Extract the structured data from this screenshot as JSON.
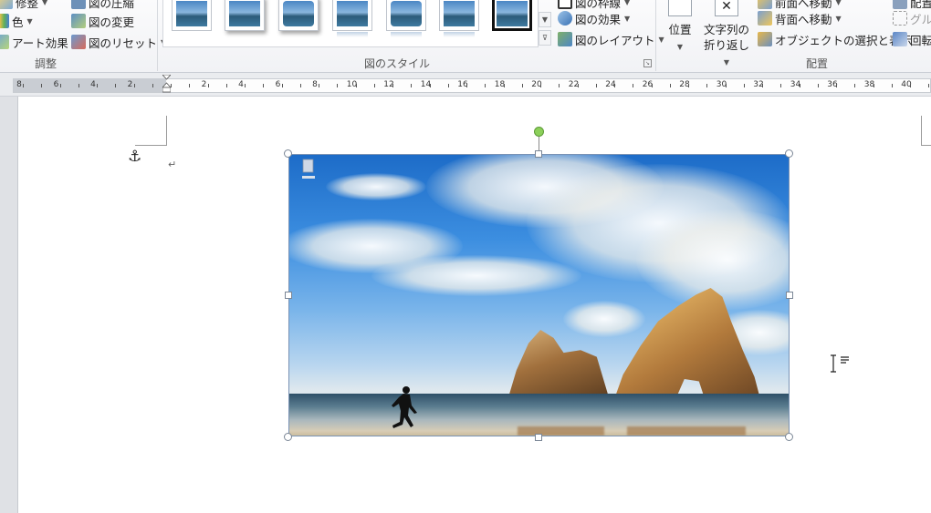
{
  "ribbon": {
    "adjust": {
      "label": "調整",
      "items_left": [
        {
          "label": "修整",
          "icon": "corrections-icon"
        },
        {
          "label": "色",
          "icon": "color-icon"
        },
        {
          "label": "アート効果",
          "icon": "artistic-effects-icon"
        }
      ],
      "items_right": [
        {
          "label": "図の圧縮",
          "icon": "compress-pictures-icon"
        },
        {
          "label": "図の変更",
          "icon": "change-picture-icon"
        },
        {
          "label": "図のリセット",
          "icon": "reset-picture-icon"
        }
      ]
    },
    "picture_styles": {
      "label": "図のスタイル",
      "style_count": 7,
      "selected_index": 6,
      "options": [
        {
          "label": "図の枠線",
          "icon": "picture-border-icon"
        },
        {
          "label": "図の効果",
          "icon": "picture-effects-icon"
        },
        {
          "label": "図のレイアウト",
          "icon": "picture-layout-icon"
        }
      ]
    },
    "arrange": {
      "label": "配置",
      "position_label": "位置",
      "wrap_label_1": "文字列の",
      "wrap_label_2": "折り返し",
      "items": [
        {
          "label": "前面へ移動",
          "icon": "bring-forward-icon"
        },
        {
          "label": "背面へ移動",
          "icon": "send-backward-icon"
        },
        {
          "label": "オブジェクトの選択と表示",
          "icon": "selection-pane-icon"
        }
      ],
      "items_right": [
        {
          "label": "配置",
          "icon": "align-icon"
        },
        {
          "label": "グループ化",
          "icon": "group-icon"
        },
        {
          "label": "回転",
          "icon": "rotate-icon"
        }
      ]
    }
  },
  "ruler": {
    "left_labels": [
      "8",
      "6",
      "4",
      "2"
    ],
    "right_labels": [
      "2",
      "4",
      "6",
      "8",
      "10",
      "12",
      "14",
      "16",
      "18",
      "20",
      "22",
      "24",
      "26",
      "28",
      "30",
      "32",
      "34",
      "36",
      "38",
      "40"
    ]
  },
  "document": {
    "paragraph_mark": "↵",
    "anchor_symbol": "⚓"
  },
  "colors": {
    "ribbon_bg": "#f1f2f5",
    "selection_handle": "#7a8696",
    "rotate_handle": "#8cd05a"
  }
}
